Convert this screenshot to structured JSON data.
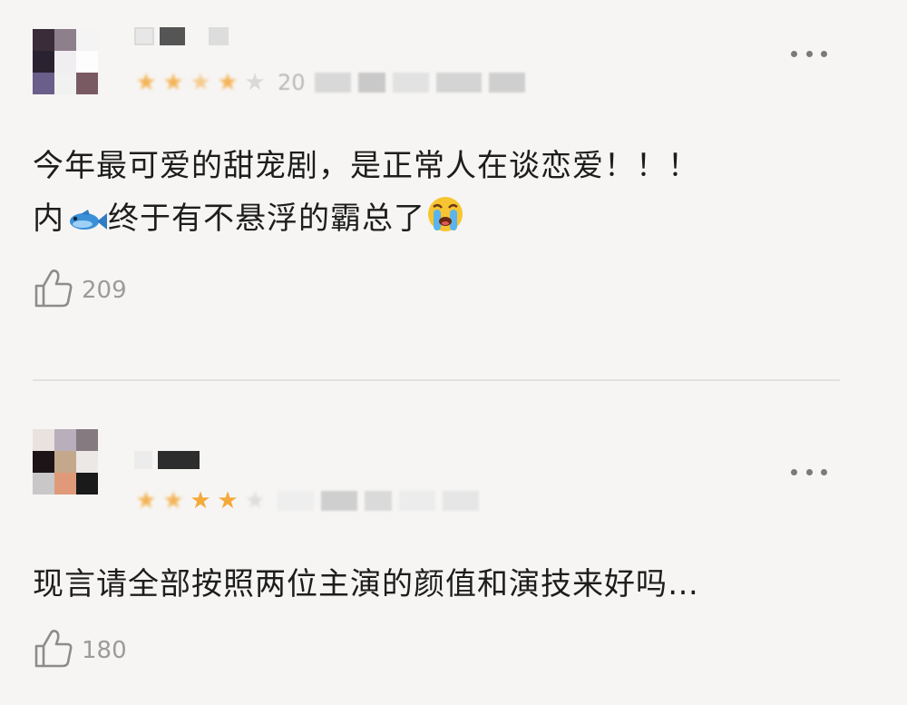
{
  "comments": [
    {
      "text_line1": "今年最可爱的甜宠剧，是正常人在谈恋爱！！！",
      "text_line2a": "内",
      "text_line2b": "终于有不悬浮的霸总了",
      "date_prefix": "20",
      "likes": "209",
      "stars_filled": 4,
      "stars_total": 5,
      "emoji_1": "fish-emoji",
      "emoji_2": "crying-face-emoji"
    },
    {
      "text_line1": "现言请全部按照两位主演的颜值和演技来好吗…",
      "likes": "180",
      "stars_filled": 4,
      "stars_total": 5
    }
  ],
  "icons": {
    "more": "more-horizontal-icon",
    "like": "thumbs-up-icon",
    "star": "star-icon"
  },
  "colors": {
    "background": "#f6f5f3",
    "star_active": "#f4a93b",
    "star_inactive": "#d9d9d9",
    "meta_text": "#9b9b9b"
  }
}
